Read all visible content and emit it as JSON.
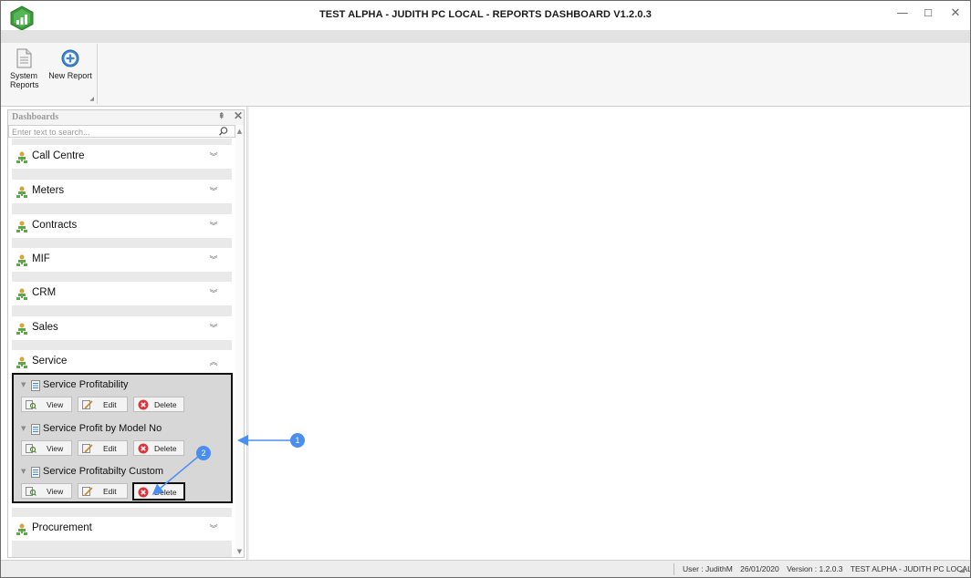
{
  "window": {
    "title": "TEST ALPHA - JUDITH PC LOCAL - REPORTS DASHBOARD V1.2.0.3",
    "controls": {
      "minimize": "—",
      "maximize": "☐",
      "close": "✕"
    }
  },
  "ribbon": {
    "system_reports_label_1": "System",
    "system_reports_label_2": "Reports",
    "new_report_label": "New Report"
  },
  "panel": {
    "title": "Dashboards",
    "pin": "⇞",
    "close": "✕",
    "search_placeholder": "Enter text to search..."
  },
  "groups": [
    {
      "label": "Call Centre",
      "state": "collapsed",
      "chevron": "︾"
    },
    {
      "label": "Meters",
      "state": "collapsed",
      "chevron": "︾"
    },
    {
      "label": "Contracts",
      "state": "collapsed",
      "chevron": "︾"
    },
    {
      "label": "MIF",
      "state": "collapsed",
      "chevron": "︾"
    },
    {
      "label": "CRM",
      "state": "collapsed",
      "chevron": "︾"
    },
    {
      "label": "Sales",
      "state": "collapsed",
      "chevron": "︾"
    },
    {
      "label": "Service",
      "state": "expanded",
      "chevron": "︽"
    },
    {
      "label": "Procurement",
      "state": "collapsed",
      "chevron": "︾"
    }
  ],
  "service_items": [
    {
      "label": "Service Profitability",
      "view": "View",
      "edit": "Edit",
      "delete": "Delete"
    },
    {
      "label": "Service Profit by Model No",
      "view": "View",
      "edit": "Edit",
      "delete": "Delete"
    },
    {
      "label": "Service Profitabilty Custom",
      "view": "View",
      "edit": "Edit",
      "delete": "Delete"
    }
  ],
  "annotations": {
    "marker_1": "1",
    "marker_2": "2"
  },
  "status": {
    "user": "User : JudithM",
    "date": "26/01/2020",
    "version": "Version : 1.2.0.3",
    "instance": "TEST ALPHA - JUDITH PC LOCAL"
  },
  "colors": {
    "accent": "#4a8ff0",
    "highlight_border": "#111111",
    "delete_icon": "#d9363e",
    "logo_green": "#3a9a3a"
  }
}
